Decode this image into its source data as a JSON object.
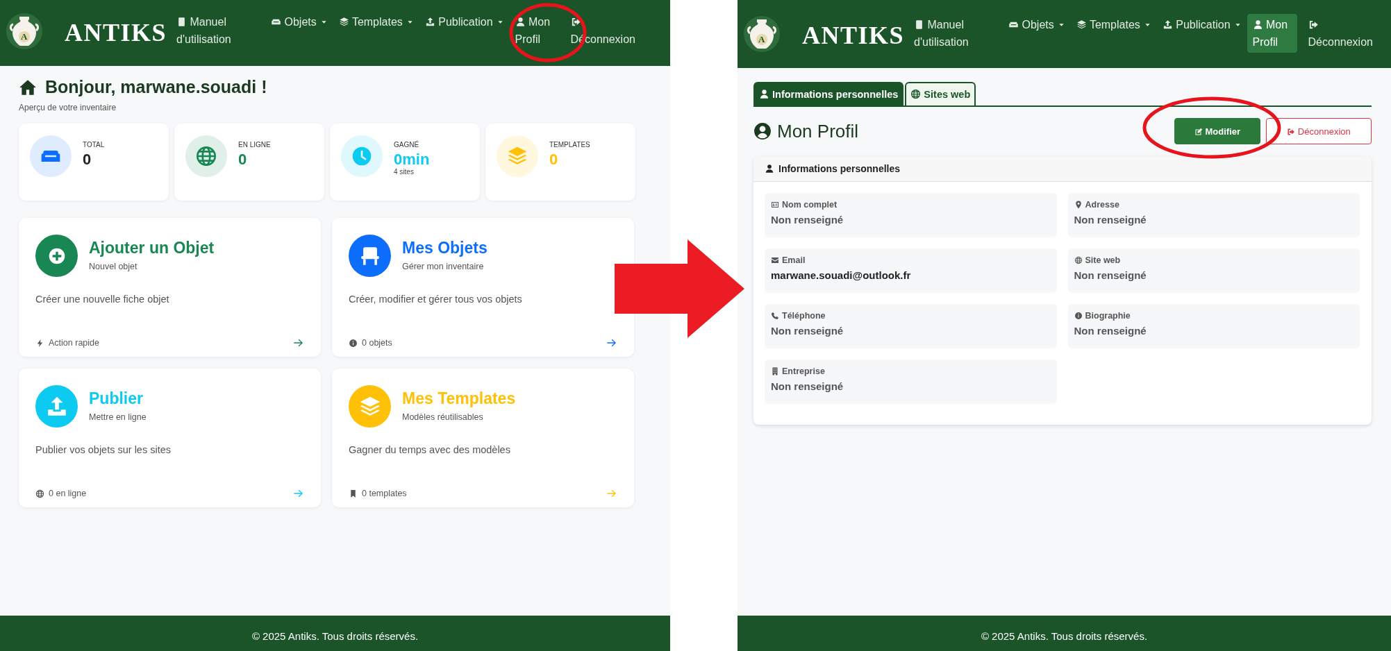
{
  "left_screen": {
    "brand": {
      "name": "ANTIKS",
      "logo_letter": "A"
    },
    "nav": [
      {
        "label": "Manuel d'utilisation",
        "dropdown": false,
        "selected": false
      },
      {
        "label": "Objets",
        "dropdown": true,
        "selected": false
      },
      {
        "label": "Templates",
        "dropdown": true,
        "selected": false
      },
      {
        "label": "Publication",
        "dropdown": true,
        "selected": false
      },
      {
        "label": "Mon Profil",
        "dropdown": false,
        "selected": false
      },
      {
        "label": "Déconnexion",
        "dropdown": false,
        "selected": false
      }
    ],
    "greeting": {
      "title": "Bonjour, marwane.souadi !",
      "subtitle": "Aperçu de votre inventaire"
    },
    "stats": [
      {
        "label": "TOTAL",
        "value": "0",
        "color": "#0d6efd",
        "accent_value": false
      },
      {
        "label": "EN LIGNE",
        "value": "0",
        "color": "#198754",
        "accent_value": true
      },
      {
        "label": "GAGNÉ",
        "value": "0min",
        "note": "4 sites",
        "color": "#0dcaf0",
        "accent_value": true
      },
      {
        "label": "TEMPLATES",
        "value": "0",
        "color": "#ffc107",
        "accent_value": true
      }
    ],
    "cards": [
      {
        "title": "Ajouter un Objet",
        "subtitle": "Nouvel objet",
        "description": "Créer une nouvelle fiche objet",
        "footer": "Action rapide",
        "color": "#198754"
      },
      {
        "title": "Mes Objets",
        "subtitle": "Gérer mon inventaire",
        "description": "Créer, modifier et gérer tous vos objets",
        "footer": "0 objets",
        "color": "#0d6efd"
      },
      {
        "title": "Publier",
        "subtitle": "Mettre en ligne",
        "description": "Publier vos objets sur les sites",
        "footer": "0 en ligne",
        "color": "#0dcaf0"
      },
      {
        "title": "Mes Templates",
        "subtitle": "Modèles réutilisables",
        "description": "Gagner du temps avec des modèles",
        "footer": "0 templates",
        "color": "#ffc107"
      }
    ],
    "footer": "© 2025 Antiks. Tous droits réservés."
  },
  "right_screen": {
    "brand": {
      "name": "ANTIKS",
      "logo_letter": "A"
    },
    "nav": [
      {
        "label": "Manuel d'utilisation",
        "dropdown": false,
        "selected": false
      },
      {
        "label": "Objets",
        "dropdown": true,
        "selected": false
      },
      {
        "label": "Templates",
        "dropdown": true,
        "selected": false
      },
      {
        "label": "Publication",
        "dropdown": true,
        "selected": false
      },
      {
        "label": "Mon Profil",
        "dropdown": false,
        "selected": true
      },
      {
        "label": "Déconnexion",
        "dropdown": false,
        "selected": false
      }
    ],
    "tabs": [
      {
        "label": "Informations personnelles",
        "selected": true
      },
      {
        "label": "Sites web",
        "selected": false
      }
    ],
    "title": "Mon Profil",
    "actions": [
      {
        "label": "Modifier",
        "kind": "primary"
      },
      {
        "label": "Déconnexion",
        "kind": "danger-outline"
      }
    ],
    "section": {
      "title": "Informations personnelles",
      "fields": [
        {
          "label": "Nom complet",
          "value": "Non renseigné",
          "empty": true
        },
        {
          "label": "Adresse",
          "value": "Non renseigné",
          "empty": true
        },
        {
          "label": "Email",
          "value": "marwane.souadi@outlook.fr",
          "empty": false
        },
        {
          "label": "Site web",
          "value": "Non renseigné",
          "empty": true
        },
        {
          "label": "Téléphone",
          "value": "Non renseigné",
          "empty": true
        },
        {
          "label": "Biographie",
          "value": "Non renseigné",
          "empty": true
        },
        {
          "label": "Entreprise",
          "value": "Non renseigné",
          "empty": true
        }
      ]
    },
    "footer": "© 2025 Antiks. Tous droits réservés."
  }
}
